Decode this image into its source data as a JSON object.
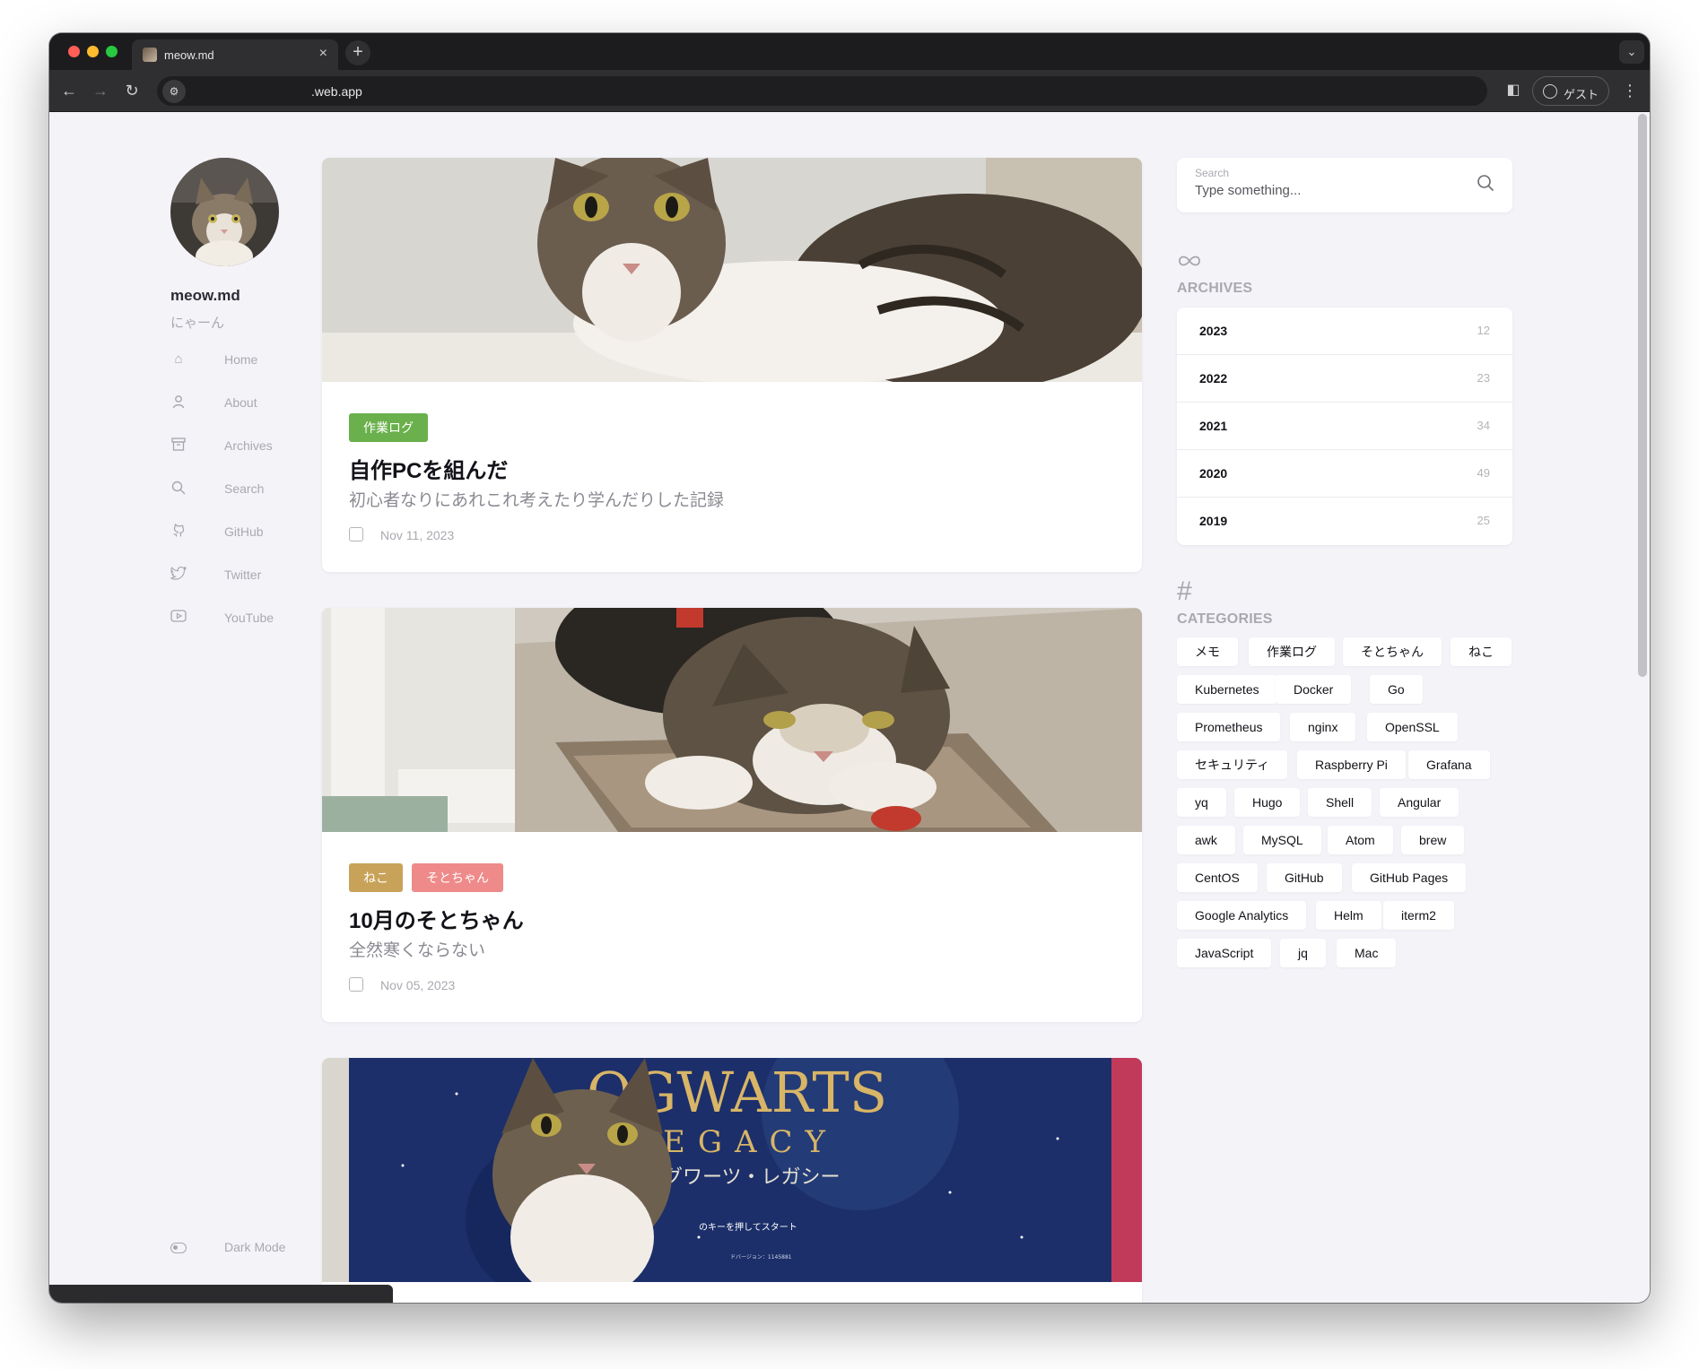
{
  "browser": {
    "tab_title": "meow.md",
    "url": ".web.app",
    "profile_label": "ゲスト"
  },
  "site": {
    "title": "meow.md",
    "subtitle": "にゃーん"
  },
  "nav": [
    {
      "label": "Home",
      "icon": "home-icon"
    },
    {
      "label": "About",
      "icon": "person-icon"
    },
    {
      "label": "Archives",
      "icon": "archive-icon"
    },
    {
      "label": "Search",
      "icon": "search-icon"
    },
    {
      "label": "GitHub",
      "icon": "github-icon"
    },
    {
      "label": "Twitter",
      "icon": "twitter-icon"
    },
    {
      "label": "YouTube",
      "icon": "youtube-icon"
    }
  ],
  "dark_mode_label": "Dark Mode",
  "posts": [
    {
      "tags": [
        {
          "label": "作業ログ",
          "color": "#6ab04c"
        }
      ],
      "title": "自作PCを組んだ",
      "description": "初心者なりにあれこれ考えたり学んだりした記録",
      "date": "Nov 11, 2023"
    },
    {
      "tags": [
        {
          "label": "ねこ",
          "color": "#c9a25a"
        },
        {
          "label": "そとちゃん",
          "color": "#ef8a8a"
        }
      ],
      "title": "10月のそとちゃん",
      "description": "全然寒くならない",
      "date": "Nov 05, 2023"
    },
    {
      "image_text": {
        "title_line": "OGWARTS",
        "legacy": "EGACY",
        "jp_title": "グワーツ・レガシー",
        "prompt": "のキーを押してスタート",
        "version": "ドバージョン：1145881"
      }
    }
  ],
  "search": {
    "label": "Search",
    "placeholder": "Type something..."
  },
  "archives": {
    "heading": "ARCHIVES",
    "icon": "infinity-icon",
    "items": [
      {
        "year": "2023",
        "count": "12"
      },
      {
        "year": "2022",
        "count": "23"
      },
      {
        "year": "2021",
        "count": "34"
      },
      {
        "year": "2020",
        "count": "49"
      },
      {
        "year": "2019",
        "count": "25"
      }
    ]
  },
  "categories": {
    "heading": "CATEGORIES",
    "icon": "hash-icon",
    "rows": [
      [
        "メモ",
        "作業ログ",
        "そとちゃん",
        "ねこ"
      ],
      [
        "Kubernetes",
        "Docker",
        "Go"
      ],
      [
        "Prometheus",
        "nginx",
        "OpenSSL"
      ],
      [
        "セキュリティ",
        "Raspberry Pi",
        "Grafana"
      ],
      [
        "yq",
        "Hugo",
        "Shell",
        "Angular"
      ],
      [
        "awk",
        "MySQL",
        "Atom",
        "brew"
      ],
      [
        "CentOS",
        "GitHub",
        "GitHub Pages"
      ],
      [
        "Google Analytics",
        "Helm",
        "iterm2"
      ],
      [
        "JavaScript",
        "jq",
        "Mac"
      ]
    ]
  },
  "colors": {
    "page_bg": "#f3f3f8",
    "card_bg": "#ffffff",
    "muted_text": "#a9a9b0"
  }
}
